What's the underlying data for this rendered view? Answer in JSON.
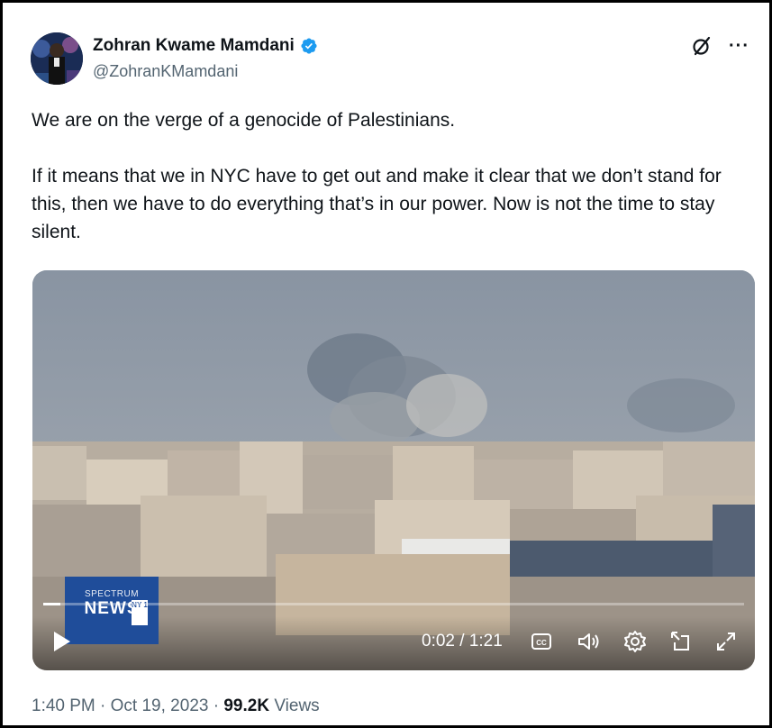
{
  "author": {
    "name": "Zohran Kwame Mamdani",
    "handle": "@ZohranKMamdani",
    "verified_color": "#1d9bf0"
  },
  "header_icons": [
    "grok-icon",
    "more-icon"
  ],
  "tweet": {
    "paragraph_1": "We are on the verge of a genocide of Palestinians.",
    "paragraph_2": "If it means that we in NYC have to get out and make it clear that we don’t stand for this, then we have to do everything that’s in our power. Now is not the time to stay silent."
  },
  "video": {
    "logo_top": "SPECTRUM",
    "logo_main": "NEWS",
    "logo_badge": "NY 1",
    "time": "0:02 / 1:21",
    "progress": 0.025,
    "controls": [
      "play-icon",
      "captions-icon",
      "volume-icon",
      "settings-icon",
      "pop-out-icon",
      "fullscreen-icon"
    ]
  },
  "meta": {
    "time": "1:40 PM",
    "date": "Oct 19, 2023",
    "views_count": "99.2K",
    "views_label": "Views"
  },
  "more_text": "···"
}
